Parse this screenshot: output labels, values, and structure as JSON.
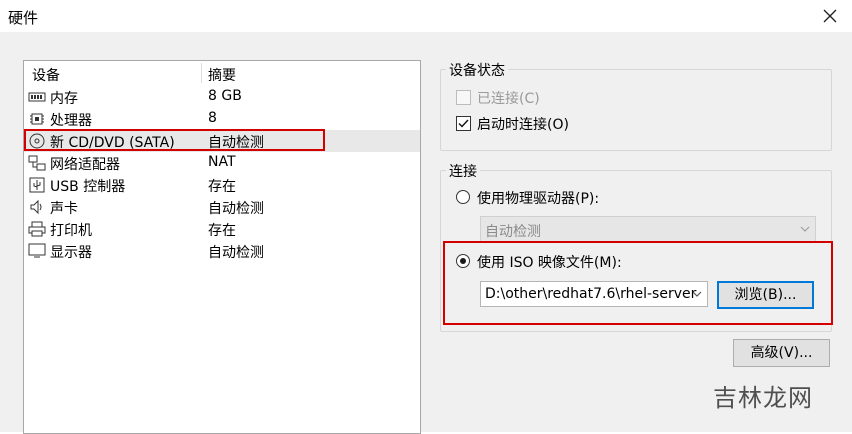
{
  "window": {
    "title": "硬件"
  },
  "device_list": {
    "col_device": "设备",
    "col_summary": "摘要",
    "items": [
      {
        "icon": "memory-icon",
        "name": "内存",
        "summary": "8 GB"
      },
      {
        "icon": "cpu-icon",
        "name": "处理器",
        "summary": "8"
      },
      {
        "icon": "cd-icon",
        "name": "新 CD/DVD (SATA)",
        "summary": "自动检测",
        "selected": true
      },
      {
        "icon": "network-icon",
        "name": "网络适配器",
        "summary": "NAT"
      },
      {
        "icon": "usb-icon",
        "name": "USB 控制器",
        "summary": "存在"
      },
      {
        "icon": "speaker-icon",
        "name": "声卡",
        "summary": "自动检测"
      },
      {
        "icon": "printer-icon",
        "name": "打印机",
        "summary": "存在"
      },
      {
        "icon": "display-icon",
        "name": "显示器",
        "summary": "自动检测"
      }
    ]
  },
  "device_status": {
    "legend": "设备状态",
    "connected_label": "已连接(C)",
    "connected_checked": false,
    "connected_disabled": true,
    "connect_on_start_label": "启动时连接(O)",
    "connect_on_start_checked": true
  },
  "connection": {
    "legend": "连接",
    "physical_label": "使用物理驱动器(P):",
    "physical_value": "自动检测",
    "iso_label": "使用 ISO 映像文件(M):",
    "iso_value": "D:\\other\\redhat7.6\\rhel-server",
    "browse_label": "浏览(B)...",
    "selected": "iso"
  },
  "advanced_label": "高级(V)...",
  "watermark": "吉林龙网",
  "colors": {
    "highlight_box": "#d40000",
    "selected_row": "#e8e8e8",
    "default_button_border": "#0078d7"
  }
}
